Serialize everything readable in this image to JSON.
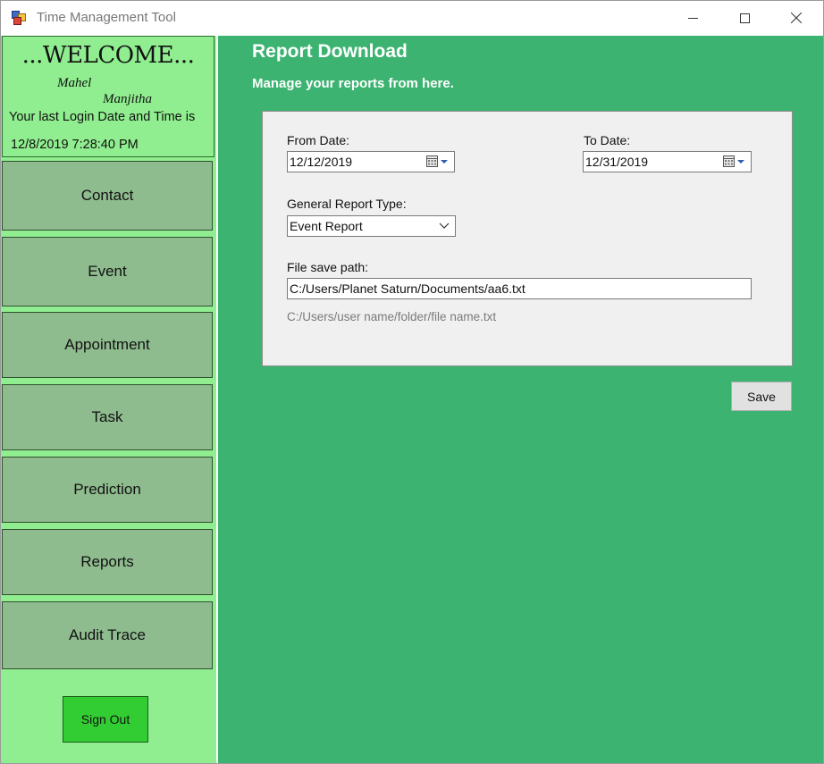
{
  "window": {
    "title": "Time Management Tool"
  },
  "sidebar": {
    "welcome_title": "...WELCOME...",
    "user_first": "Mahel",
    "user_last": "Manjitha",
    "login_label": "Your last Login Date and Time is",
    "login_value": "12/8/2019 7:28:40 PM",
    "nav": {
      "contact": "Contact",
      "event": "Event",
      "appointment": "Appointment",
      "task": "Task",
      "prediction": "Prediction",
      "reports": "Reports",
      "audit": "Audit Trace"
    },
    "signout_label": "Sign Out"
  },
  "main": {
    "title": "Report Download",
    "subtitle": "Manage your reports from here.",
    "form": {
      "from_label": "From Date:",
      "from_value": "12/12/2019",
      "to_label": "To Date:",
      "to_value": "12/31/2019",
      "type_label": "General Report Type:",
      "type_value": "Event Report",
      "path_label": "File save path:",
      "path_value": "C:/Users/Planet Saturn/Documents/aa6.txt",
      "path_hint": "C:/Users/user name/folder/file name.txt"
    },
    "save_label": "Save"
  },
  "colors": {
    "sidebar_bg": "#90ee90",
    "nav_button_bg": "#8fbc8f",
    "main_bg": "#3cb371",
    "signout_bg": "#32cd32"
  },
  "icons": [
    "app-icon",
    "minimize-icon",
    "maximize-icon",
    "close-icon",
    "calendar-icon",
    "dropdown-arrow-icon"
  ]
}
